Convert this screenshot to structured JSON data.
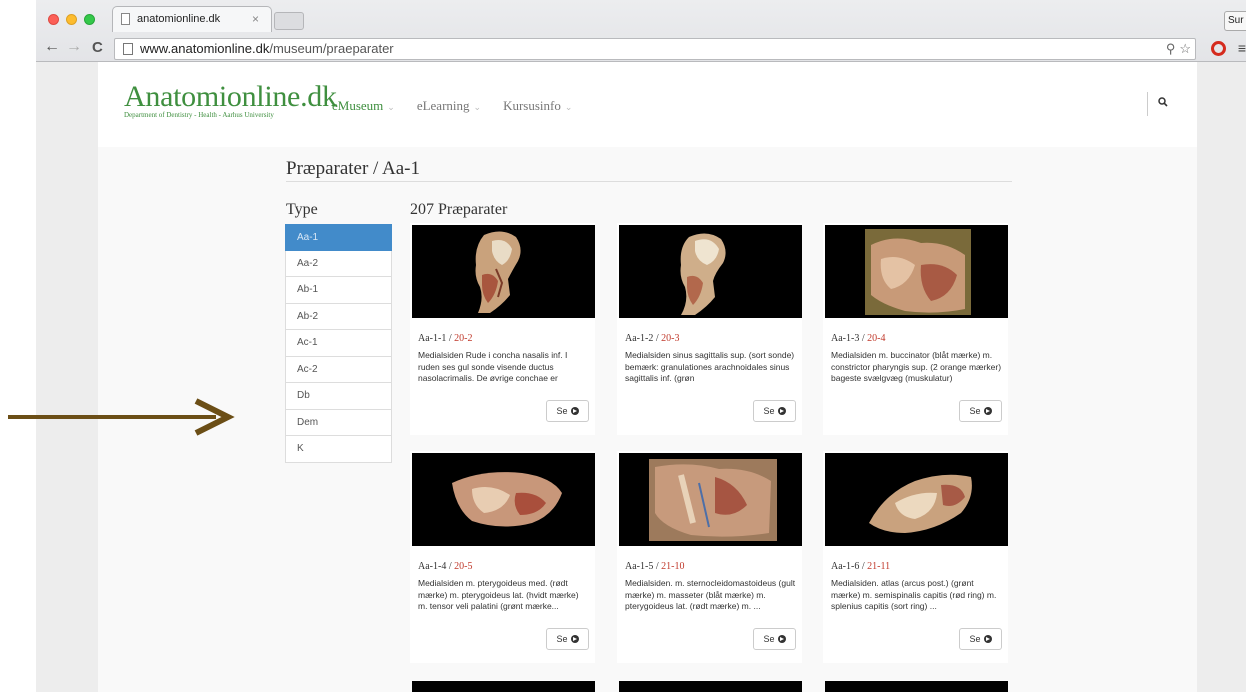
{
  "browser": {
    "tab_title": "anatomionline.dk",
    "tab_close": "×",
    "profile_button": "Sur",
    "url_domain": "www.anatomionline.dk",
    "url_path": "/museum/praeparater",
    "back_icon": "←",
    "forward_icon": "→",
    "reload_icon": "C",
    "zoom_icon": "⚲",
    "star_icon": "☆",
    "menu_icon": "≡"
  },
  "site": {
    "logo": "Anatomionline.dk",
    "logo_sub": "Department of Dentistry - Health - Aarhus University",
    "nav": [
      {
        "label": "eMuseum",
        "active": true
      },
      {
        "label": "eLearning",
        "active": false
      },
      {
        "label": "Kursusinfo",
        "active": false
      }
    ],
    "caret": "⌄"
  },
  "breadcrumb": "Præparater / Aa-1",
  "type_heading": "Type",
  "types": [
    "Aa-1",
    "Aa-2",
    "Ab-1",
    "Ab-2",
    "Ac-1",
    "Ac-2",
    "Db",
    "Dem",
    "K"
  ],
  "active_type": "Aa-1",
  "count_heading": "207 Præparater",
  "cards": [
    {
      "id": "Aa-1-1",
      "sep": " / ",
      "ref": "20-2",
      "desc": "Medialsiden Rude i concha nasalis inf. I ruden ses gul sonde visende ductus nasolacrimalis. De øvrige conchae er",
      "button": "Se"
    },
    {
      "id": "Aa-1-2",
      "sep": " / ",
      "ref": "20-3",
      "desc": "Medialsiden sinus sagittalis sup. (sort sonde) bemærk: granulationes arachnoidales sinus sagittalis inf. (grøn",
      "button": "Se"
    },
    {
      "id": "Aa-1-3",
      "sep": " / ",
      "ref": "20-4",
      "desc": "Medialsiden m. buccinator (blåt mærke) m. constrictor pharyngis sup. (2 orange mærker) bageste svælgvæg (muskulatur)",
      "button": "Se"
    },
    {
      "id": "Aa-1-4",
      "sep": " / ",
      "ref": "20-5",
      "desc": "Medialsiden m. pterygoideus med. (rødt mærke) m. pterygoideus lat. (hvidt mærke) m. tensor veli palatini (grønt mærke...",
      "button": "Se"
    },
    {
      "id": "Aa-1-5",
      "sep": " / ",
      "ref": "21-10",
      "desc": "Medialsiden. m. sternocleidomastoideus (gult mærke) m. masseter (blåt mærke) m. pterygoideus lat. (rødt mærke) m. ...",
      "button": "Se"
    },
    {
      "id": "Aa-1-6",
      "sep": " / ",
      "ref": "21-11",
      "desc": "Medialsiden. atlas (arcus post.) (grønt mærke) m. semispinalis capitis (rød ring) m. splenius capitis (sort ring) ...",
      "button": "Se"
    }
  ],
  "colors": {
    "accent_green": "#3f8f3f",
    "active_blue": "#428bca",
    "ref_red": "#c0392b",
    "annotation_arrow": "#6b4e16"
  }
}
